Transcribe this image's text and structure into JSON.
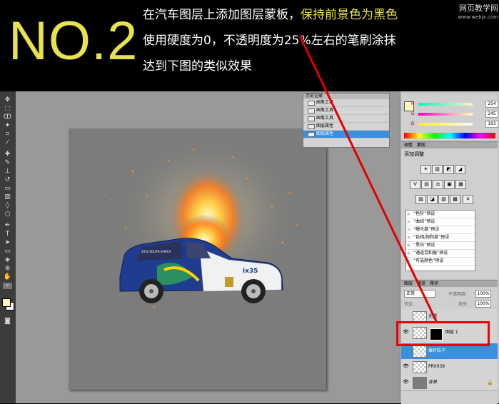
{
  "banner": {
    "step": "NO.2",
    "line1_white": "在汽车图层上添加图层蒙板，",
    "line1_yellow": "保持前景色为黑色",
    "line2": "使用硬度为0，不透明度为25%左右的笔刷涂抹",
    "line3": "达到下图的类似效果",
    "watermark": "网页教学网",
    "watermark_url": "www.webjx.com"
  },
  "history": {
    "title": "历史记录",
    "items": [
      "画笔工具",
      "画笔工具",
      "画笔工具",
      "图层属性",
      "图层属性"
    ],
    "selected_index": 4
  },
  "color_panel": {
    "channels": [
      {
        "label": "R",
        "value": "254"
      },
      {
        "label": "G",
        "value": "245"
      },
      {
        "label": "B",
        "value": "193"
      }
    ],
    "foreground": "#fef5c1"
  },
  "adjustments": {
    "tabs": [
      "调整",
      "蒙版"
    ],
    "title": "添加调整",
    "icons_row1": [
      "☀",
      "▥",
      "◩",
      "◢"
    ],
    "icons_row2": [
      "V",
      "▤",
      "⚖",
      "▣",
      "▦"
    ],
    "icons_row3": [
      "▧",
      "◪",
      "▨",
      "▩"
    ],
    "presets": [
      "“色阶”预设",
      "“曲线”预设",
      "“曝光度”预设",
      "“色相/饱和度”预设",
      "“黑白”预设",
      "“通道混和器”预设",
      "“可选颜色”预设"
    ]
  },
  "layers": {
    "tabs": [
      "图层",
      "通道",
      "路径"
    ],
    "blend_mode": "正常",
    "opacity_label": "不透明度:",
    "opacity": "100%",
    "lock_label": "锁定:",
    "fill_label": "填充:",
    "fill": "100%",
    "items": [
      {
        "name": "光照",
        "visible": false,
        "selected": false
      },
      {
        "name": "图层 1",
        "visible": true,
        "selected": false,
        "mask": true
      },
      {
        "name": "爆炸粒子",
        "visible": false,
        "selected": true
      },
      {
        "name": "PR0038",
        "visible": true,
        "selected": false
      },
      {
        "name": "背景",
        "visible": true,
        "selected": false
      }
    ]
  },
  "car": {
    "badge": "ix35",
    "roof_text": "2010 SOUTH AFRICA"
  },
  "colors": {
    "accent_yellow": "#e8e24f",
    "selection_blue": "#3a8fe0",
    "annotation_red": "#e00000"
  }
}
